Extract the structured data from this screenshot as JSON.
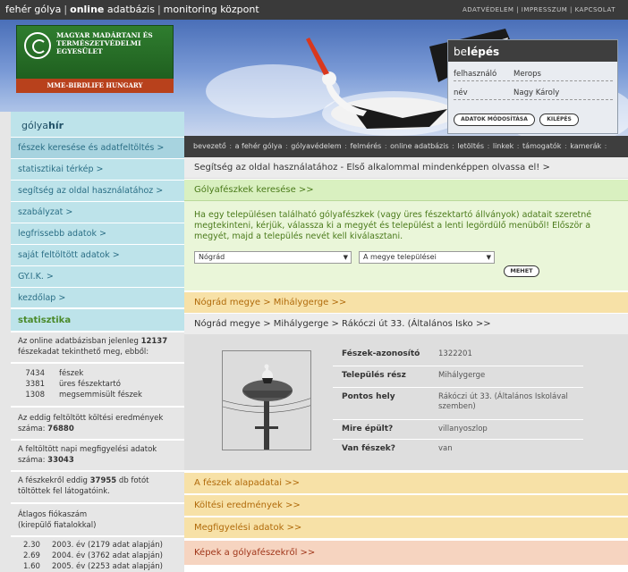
{
  "topbar": {
    "brand_part1": "fehér gólya",
    "brand_part2_bold": "online",
    "brand_part2_rest": " adatbázis",
    "brand_part3": "monitoring központ",
    "links": [
      "ADATVÉDELEM",
      "IMPRESSZUM",
      "KAPCSOLAT"
    ]
  },
  "logo": {
    "org_name": "MAGYAR MADÁRTANI ÉS TERMÉSZETVÉDELMI EGYESÜLET",
    "subtitle": "MME-BIRDLIFE HUNGARY"
  },
  "login": {
    "title_pre": "be",
    "title_bold": "lépés",
    "user_label": "felhasználó",
    "user_value": "Merops",
    "name_label": "név",
    "name_value": "Nagy Károly",
    "modify_button": "ADATOK MÓDOSÍTÁSA",
    "logout_button": "KILÉPÉS"
  },
  "crumbs": [
    "bevezető",
    "a fehér gólya",
    "gólyavédelem",
    "felmérés",
    "online adatbázis",
    "letöltés",
    "linkek",
    "támogatók",
    "kamerák"
  ],
  "sidebar": {
    "head_pre": "gólya",
    "head_bold": "hír",
    "items": [
      "fészek keresése és adatfeltöltés >",
      "statisztikai térkép >",
      "segítség az oldal használatához >",
      "szabályzat >",
      "legfrissebb adatok >",
      "saját feltöltött adatok >",
      "GY.I.K. >",
      "kezdőlap >"
    ],
    "stat_head": "statisztika",
    "stat_intro_a": "Az online adatbázisban jelenleg",
    "stat_intro_num": "12137",
    "stat_intro_b": "fészekadat tekinthető meg, ebből:",
    "counts": [
      {
        "n": "7434",
        "t": "fészek"
      },
      {
        "n": "3381",
        "t": "üres fészektartó"
      },
      {
        "n": "1308",
        "t": "megsemmisült fészek"
      }
    ],
    "nesting_a": "Az eddig feltöltött költési eredmények száma:",
    "nesting_num": "76880",
    "daily_a": "A feltöltött napi megfigyelési adatok száma:",
    "daily_num": "33043",
    "photos_a": "A fészkekről eddig",
    "photos_num": "37955",
    "photos_b": "db fotót töltöttek fel látogatóink.",
    "avg_title": "Átlagos fiókaszám",
    "avg_sub": "(kirepülő fiatalokkal)",
    "years": [
      {
        "n": "2.30",
        "t": "2003. év (2179 adat alapján)"
      },
      {
        "n": "2.69",
        "t": "2004. év (3762 adat alapján)"
      },
      {
        "n": "1.60",
        "t": "2005. év (2253 adat alapján)"
      }
    ]
  },
  "main": {
    "help_bar": "Segítség az oldal használatához - Első alkalommal mindenképpen olvassa el! >",
    "search_bar": "Gólyafészkek keresése >>",
    "search_desc": "Ha egy településen található gólyafészkek (vagy üres fészektartó állványok) adatait szeretné megtekinteni, kérjük, válassza ki a megyét és települést a lenti legördülő menüből! Először a megyét, majd a település nevét kell kiválasztani.",
    "county_select": "Nógrád",
    "town_select": "A megye települései",
    "go_button": "MEHET",
    "county_bar": "Nógrád megye > Mihálygerge >>",
    "place_bar": "Nógrád megye > Mihálygerge > Rákóczi út 33. (Általános Isko >>",
    "details": [
      {
        "k": "Fészek-azonosító",
        "v": "1322201"
      },
      {
        "k": "Település rész",
        "v": "Mihálygerge"
      },
      {
        "k": "Pontos hely",
        "v": "Rákóczi út 33. (Általános Iskolával szemben)"
      },
      {
        "k": "Mire épült?",
        "v": "villanyoszlop"
      },
      {
        "k": "Van fészek?",
        "v": "van"
      }
    ],
    "basics_bar": "A fészek alapadatai >>",
    "nesting_bar": "Költési eredmények >>",
    "obs_bar": "Megfigyelési adatok >>",
    "images_bar": "Képek a gólyafészekről >>"
  },
  "colors": {
    "topbar": "#3a3a3a",
    "nav_bg": "#bde3ea",
    "search_green": "#d9f0c0",
    "orange_bar": "#f7e1a7",
    "images_bar": "#f6d4c0"
  }
}
